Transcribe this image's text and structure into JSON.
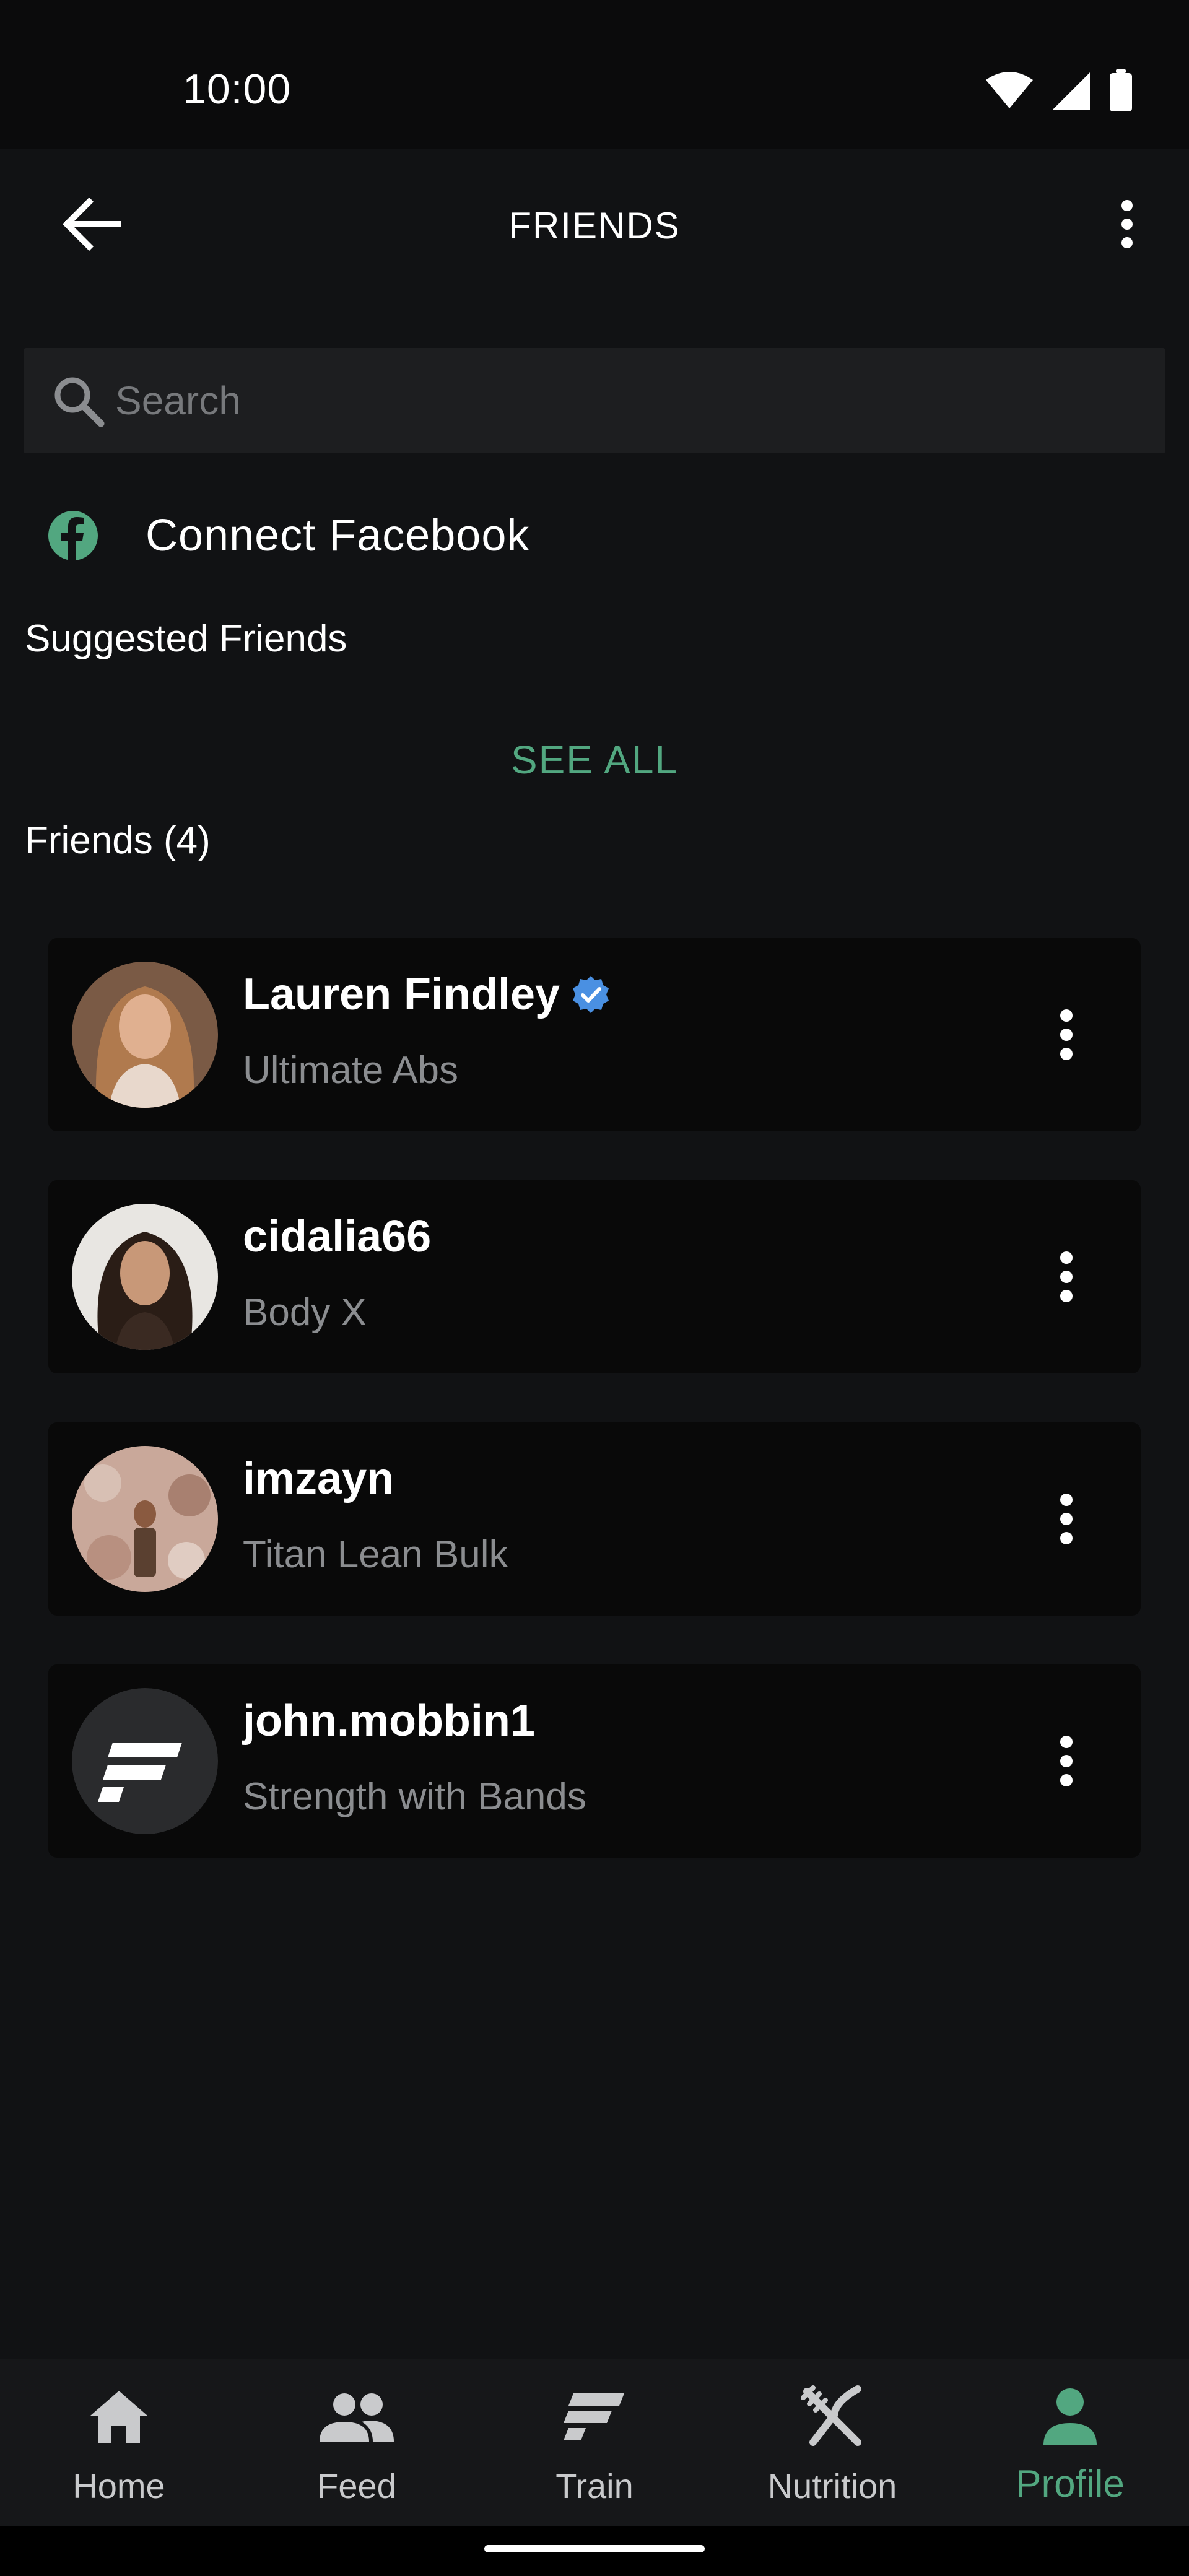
{
  "status_bar": {
    "time": "10:00"
  },
  "app_bar": {
    "title": "FRIENDS",
    "back_icon": "arrow-left-icon",
    "overflow_icon": "more-vertical-icon"
  },
  "search": {
    "placeholder": "Search",
    "icon": "search-icon"
  },
  "connect_facebook": {
    "label": "Connect Facebook",
    "icon": "facebook-icon"
  },
  "suggested": {
    "title": "Suggested Friends",
    "see_all": "SEE ALL"
  },
  "friends": {
    "title": "Friends (4)",
    "items": [
      {
        "name": "Lauren Findley",
        "program": "Ultimate Abs",
        "verified": true
      },
      {
        "name": "cidalia66",
        "program": "Body X",
        "verified": false
      },
      {
        "name": "imzayn",
        "program": "Titan Lean Bulk",
        "verified": false
      },
      {
        "name": "john.mobbin1",
        "program": "Strength with Bands",
        "verified": false
      }
    ]
  },
  "bottom_nav": {
    "items": [
      {
        "label": "Home",
        "icon": "home-icon"
      },
      {
        "label": "Feed",
        "icon": "people-icon"
      },
      {
        "label": "Train",
        "icon": "train-logo-icon"
      },
      {
        "label": "Nutrition",
        "icon": "fork-knife-icon"
      },
      {
        "label": "Profile",
        "icon": "person-icon",
        "active": true
      }
    ]
  },
  "colors": {
    "accent": "#52a780",
    "background": "#111214",
    "card": "#090909",
    "verified": "#4a90e2"
  }
}
